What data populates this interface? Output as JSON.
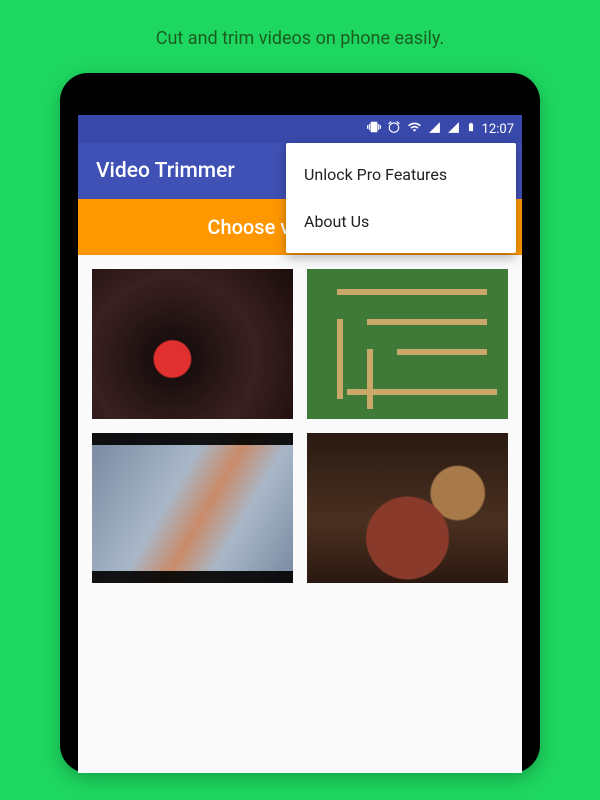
{
  "promo": {
    "tagline": "Cut and trim videos on phone easily."
  },
  "statusbar": {
    "time": "12:07"
  },
  "appbar": {
    "title": "Video Trimmer"
  },
  "actions": {
    "choose_label": "Choose video to trim"
  },
  "menu": {
    "items": [
      {
        "label": "Unlock Pro Features"
      },
      {
        "label": "About Us"
      }
    ]
  },
  "grid": {
    "thumbnails": [
      {
        "name": "video-thumbnail-1"
      },
      {
        "name": "video-thumbnail-2"
      },
      {
        "name": "video-thumbnail-3"
      },
      {
        "name": "video-thumbnail-4"
      }
    ]
  }
}
